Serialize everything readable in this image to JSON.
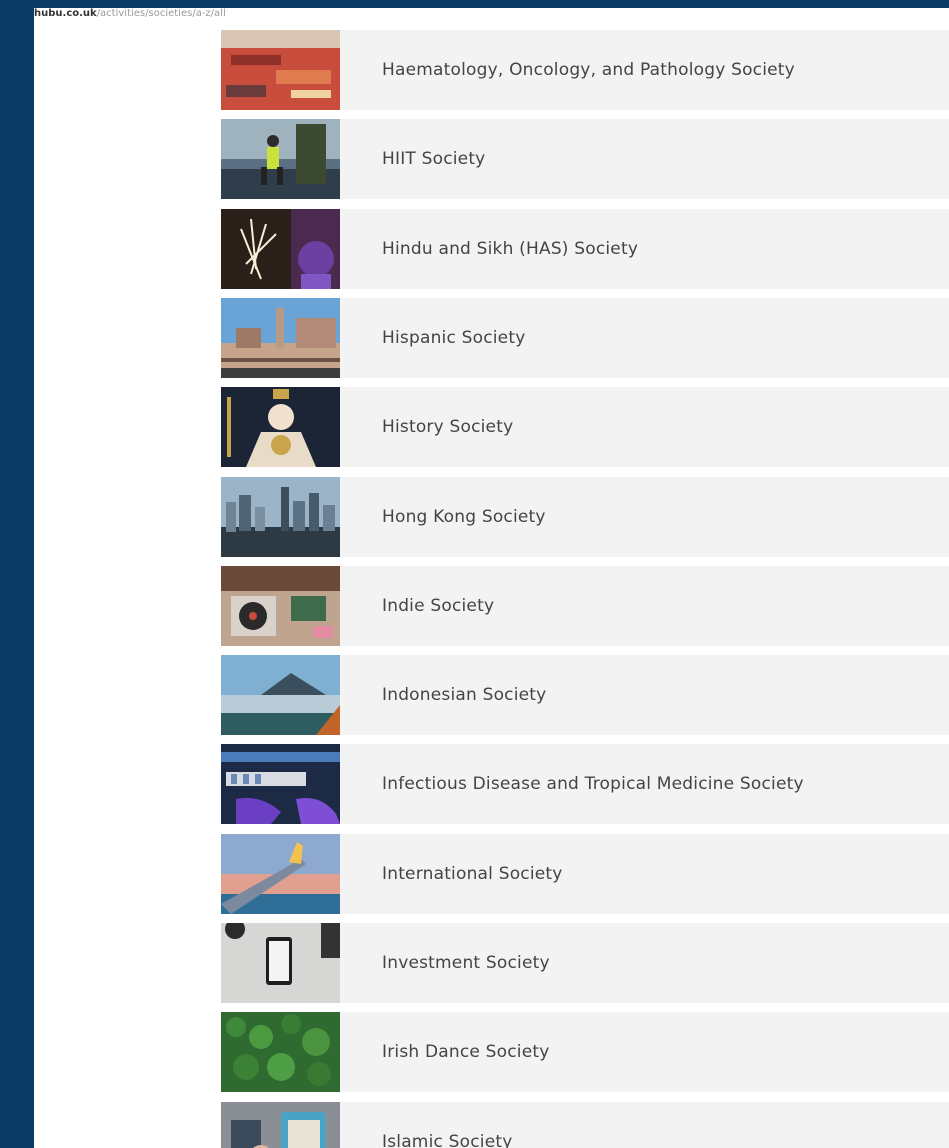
{
  "url": {
    "domain": "hubu.co.uk",
    "path": "/activities/societies/a-z/all"
  },
  "societies": [
    {
      "name": "Haematology, Oncology, and Pathology Society",
      "image": "red-graffiti-wall-image"
    },
    {
      "name": "HIIT Society",
      "image": "runner-by-river-image"
    },
    {
      "name": "Hindu and Sikh (HAS) Society",
      "image": "fireworks-sparkler-image"
    },
    {
      "name": "Hispanic Society",
      "image": "city-hall-building-image"
    },
    {
      "name": "History Society",
      "image": "queen-portrait-image"
    },
    {
      "name": "Hong Kong Society",
      "image": "hong-kong-skyline-image"
    },
    {
      "name": "Indie Society",
      "image": "vinyl-record-player-image"
    },
    {
      "name": "Indonesian Society",
      "image": "volcano-landscape-image"
    },
    {
      "name": "Infectious Disease and Tropical Medicine Society",
      "image": "lab-test-tubes-image"
    },
    {
      "name": "International Society",
      "image": "airplane-wing-sunset-image"
    },
    {
      "name": "Investment Society",
      "image": "smartphone-on-desk-image"
    },
    {
      "name": "Irish Dance Society",
      "image": "clover-leaves-image"
    },
    {
      "name": "Islamic Society",
      "image": "person-reading-book-image"
    }
  ]
}
